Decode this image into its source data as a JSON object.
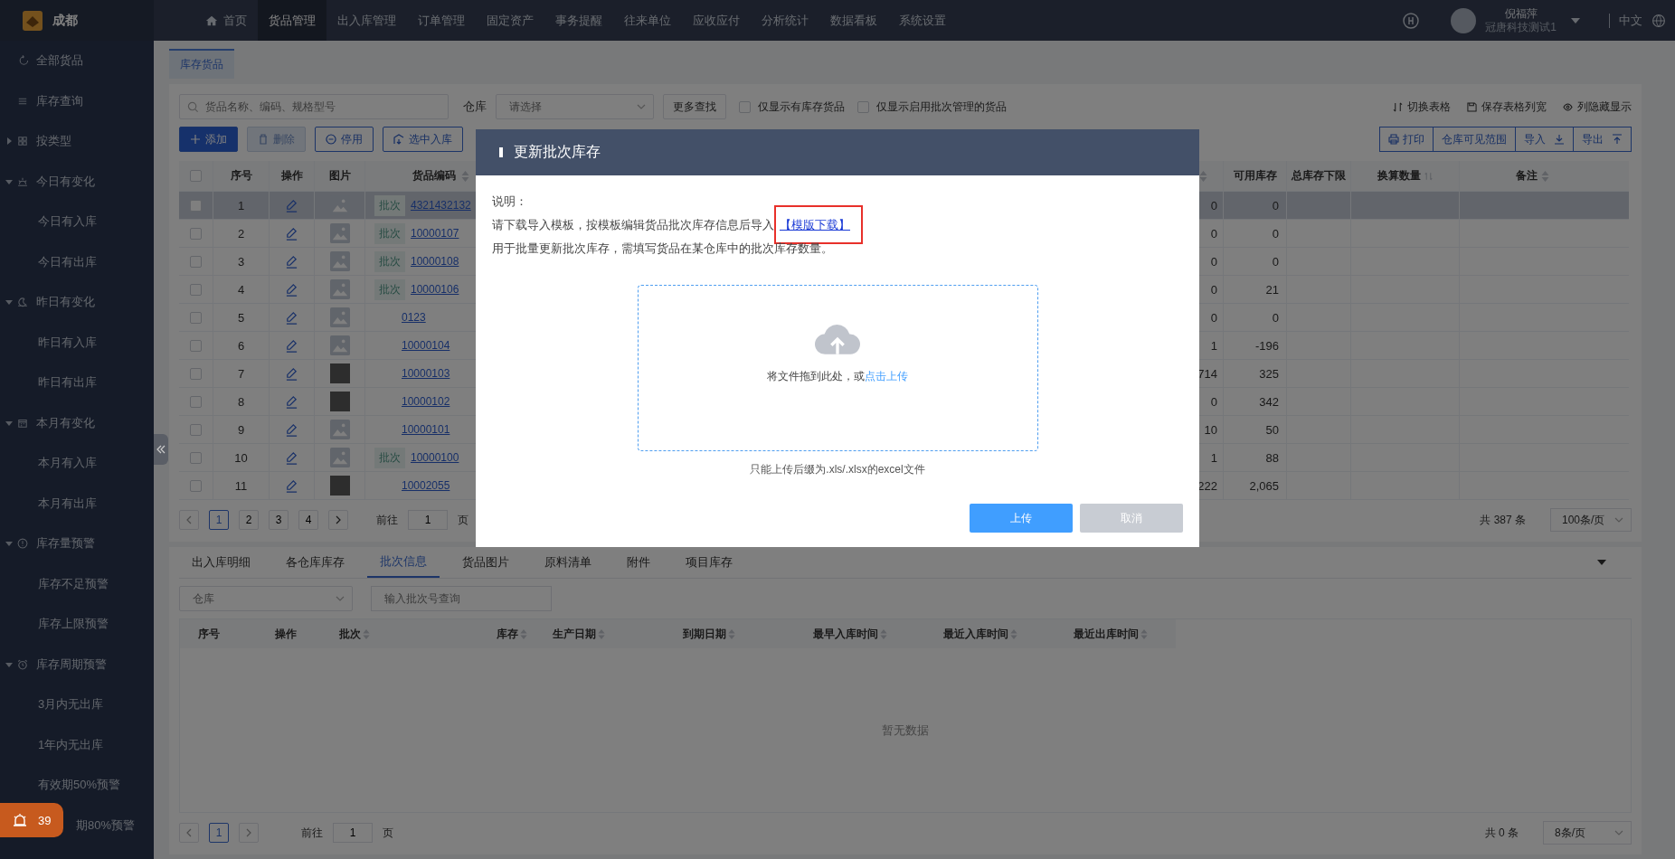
{
  "top_bar": {
    "brand": "成都",
    "nav": [
      {
        "label": "首页",
        "selected": false
      },
      {
        "label": "货品管理",
        "selected": true
      },
      {
        "label": "出入库管理",
        "selected": false
      },
      {
        "label": "订单管理",
        "selected": false
      },
      {
        "label": "固定资产",
        "selected": false
      },
      {
        "label": "事务提醒",
        "selected": false
      },
      {
        "label": "往来单位",
        "selected": false
      },
      {
        "label": "应收应付",
        "selected": false
      },
      {
        "label": "分析统计",
        "selected": false
      },
      {
        "label": "数据看板",
        "selected": false
      },
      {
        "label": "系统设置",
        "selected": false
      }
    ],
    "user": {
      "name": "倪福萍",
      "company": "冠唐科技测试1"
    },
    "language": "中文"
  },
  "sidebar": {
    "items": [
      {
        "label": "全部货品"
      },
      {
        "label": "库存查询"
      },
      {
        "label": "按类型",
        "expanded": false
      },
      {
        "label": "今日有变化",
        "expanded": true,
        "children": [
          {
            "label": "今日有入库"
          },
          {
            "label": "今日有出库"
          }
        ]
      },
      {
        "label": "昨日有变化",
        "expanded": true,
        "children": [
          {
            "label": "昨日有入库"
          },
          {
            "label": "昨日有出库"
          }
        ]
      },
      {
        "label": "本月有变化",
        "expanded": true,
        "children": [
          {
            "label": "本月有入库"
          },
          {
            "label": "本月有出库"
          }
        ]
      },
      {
        "label": "库存量预警",
        "expanded": true,
        "children": [
          {
            "label": "库存不足预警"
          },
          {
            "label": "库存上限预警"
          }
        ]
      },
      {
        "label": "库存周期预警",
        "expanded": true,
        "children": [
          {
            "label": "3月内无出库"
          },
          {
            "label": "1年内无出库"
          },
          {
            "label": "有效期50%预警"
          },
          {
            "label": "期80%预警"
          }
        ]
      }
    ]
  },
  "alert_badge": {
    "count": "39"
  },
  "page_tabs": [
    {
      "label": "库存货品",
      "selected": true
    }
  ],
  "filters": {
    "search": {
      "placeholder": "货品名称、编码、规格型号"
    },
    "warehouse": {
      "label": "仓库",
      "placeholder": "请选择"
    },
    "more_button": "更多查找",
    "checkboxes": [
      {
        "label": "仅显示有库存货品",
        "checked": false
      },
      {
        "label": "仅显示启用批次管理的货品",
        "checked": false
      }
    ]
  },
  "view_links": [
    "切换表格",
    "保存表格列宽",
    "列隐藏显示"
  ],
  "toolbar": {
    "buttons": [
      {
        "label": "添加",
        "kind": "primary",
        "disabled": false
      },
      {
        "label": "删除",
        "kind": "plain",
        "disabled": true
      },
      {
        "label": "停用",
        "kind": "plain",
        "disabled": false
      },
      {
        "label": "选中入库",
        "kind": "plain",
        "disabled": false
      }
    ],
    "right_buttons": [
      "打印",
      "仓库可见范围",
      "导入",
      "导出"
    ]
  },
  "goods_table": {
    "select_all": {
      "checked": false
    },
    "columns": [
      {
        "label": "序号",
        "sortable": false
      },
      {
        "label": "操作",
        "sortable": false
      },
      {
        "label": "图片",
        "sortable": false
      },
      {
        "label": "货品编码",
        "sortable": true
      },
      {
        "sortable": true
      },
      {
        "label": "可用库存",
        "sortable": false
      },
      {
        "label": "总库存下限",
        "sortable": false
      },
      {
        "label": "换算数量",
        "sortable": true
      },
      {
        "label": "备注",
        "sortable": true
      }
    ],
    "rows": [
      {
        "index": "1",
        "photo": false,
        "batch_tag": "批次",
        "code": "4321432132",
        "column_6": "0",
        "available": "0",
        "checked": false,
        "selected": true
      },
      {
        "index": "2",
        "photo": false,
        "batch_tag": "批次",
        "code": "10000107",
        "column_6": "0",
        "available": "0",
        "checked": false,
        "selected": false
      },
      {
        "index": "3",
        "photo": false,
        "batch_tag": "批次",
        "code": "10000108",
        "column_6": "0",
        "available": "0",
        "checked": false,
        "selected": false
      },
      {
        "index": "4",
        "photo": false,
        "batch_tag": "批次",
        "code": "10000106",
        "column_6": "0",
        "available": "21",
        "checked": false,
        "selected": false
      },
      {
        "index": "5",
        "photo": false,
        "code": "0123",
        "column_6": "0",
        "available": "0",
        "checked": false,
        "selected": false
      },
      {
        "index": "6",
        "photo": false,
        "code": "10000104",
        "column_6": "1",
        "available": "-196",
        "checked": false,
        "selected": false
      },
      {
        "index": "7",
        "photo": true,
        "code": "10000103",
        "column_6": "714",
        "available": "325",
        "checked": false,
        "selected": false
      },
      {
        "index": "8",
        "photo": true,
        "code": "10000102",
        "column_6": "0",
        "available": "342",
        "checked": false,
        "selected": false
      },
      {
        "index": "9",
        "photo": false,
        "code": "10000101",
        "column_6": "10",
        "available": "50",
        "checked": false,
        "selected": false
      },
      {
        "index": "10",
        "photo": false,
        "batch_tag": "批次",
        "code": "10000100",
        "column_6": "1",
        "available": "88",
        "checked": false,
        "selected": false
      },
      {
        "index": "11",
        "photo": true,
        "code": "10002055",
        "column_6": "222",
        "available": "2,065",
        "checked": false,
        "selected": false
      }
    ],
    "pagination": {
      "pages": [
        {
          "label": "1",
          "selected": true
        },
        {
          "label": "2",
          "selected": false
        },
        {
          "label": "3",
          "selected": false
        },
        {
          "label": "4",
          "selected": false
        }
      ],
      "goto_label": "前往",
      "goto_value": "1",
      "goto_unit": "页",
      "total": "共 387 条",
      "page_size": "100条/页"
    }
  },
  "detail_panel": {
    "tabs": [
      {
        "label": "出入库明细",
        "selected": false
      },
      {
        "label": "各仓库库存",
        "selected": false
      },
      {
        "label": "批次信息",
        "selected": true
      },
      {
        "label": "货品图片",
        "selected": false
      },
      {
        "label": "原料清单",
        "selected": false
      },
      {
        "label": "附件",
        "selected": false
      },
      {
        "label": "项目库存",
        "selected": false
      }
    ],
    "filters": {
      "warehouse_placeholder": "仓库",
      "batch_placeholder": "输入批次号查询"
    },
    "columns": [
      {
        "label": "序号",
        "sortable": false
      },
      {
        "label": "操作",
        "sortable": false
      },
      {
        "label": "批次",
        "sortable": true
      },
      {
        "label": "库存",
        "sortable": true
      },
      {
        "label": "生产日期",
        "sortable": true
      },
      {
        "label": "到期日期",
        "sortable": true
      },
      {
        "label": "最早入库时间",
        "sortable": true
      },
      {
        "label": "最近入库时间",
        "sortable": true
      },
      {
        "label": "最近出库时间",
        "sortable": true
      }
    ],
    "empty_text": "暂无数据",
    "pagination": {
      "pages": [
        {
          "label": "1",
          "selected": true
        }
      ],
      "goto_label": "前往",
      "goto_value": "1",
      "goto_unit": "页",
      "total": "共 0 条",
      "page_size": "8条/页"
    }
  },
  "modal": {
    "title": "更新批次库存",
    "note_label": "说明：",
    "instruction": "请下载导入模板，按模板编辑货品批次库存信息后导入",
    "template_link": "【模版下载】",
    "description": "用于批量更新批次库存，需填写货品在某仓库中的批次库存数量。",
    "upload": {
      "prompt": "将文件拖到此处，或",
      "link": "点击上传"
    },
    "hint": "只能上传后缀为.xls/.xlsx的excel文件",
    "buttons": [
      {
        "label": "上传",
        "kind": "primary"
      },
      {
        "label": "取消",
        "kind": "secondary"
      }
    ]
  }
}
